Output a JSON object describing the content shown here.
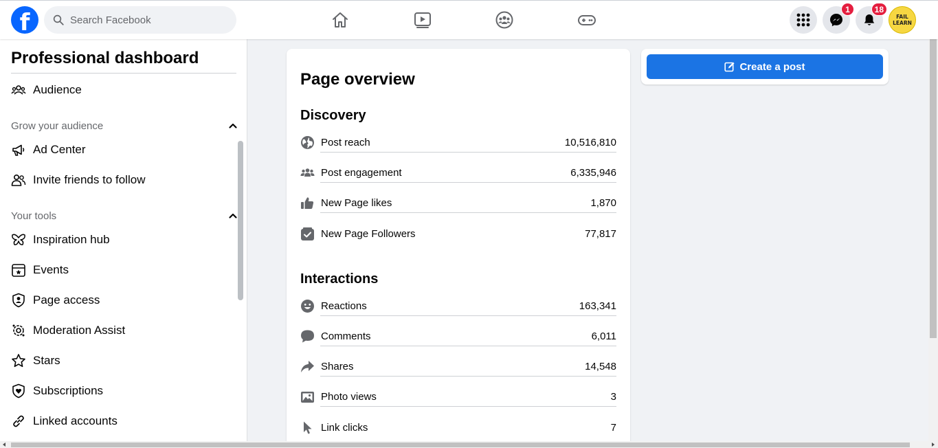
{
  "header": {
    "logo_letter": "f",
    "search_placeholder": "Search Facebook",
    "nav_icons": [
      "home-icon",
      "video-icon",
      "groups-icon",
      "gaming-icon"
    ],
    "menu_icon": "grid-menu-icon",
    "messenger_badge": "1",
    "notifications_badge": "18",
    "avatar_text": "FAIL LEARN",
    "avatar_color": "#f6d742",
    "brand_color": "#0866ff"
  },
  "sidebar": {
    "title": "Professional dashboard",
    "audience": "Audience",
    "grow_header": "Grow your audience",
    "grow_items": [
      "Ad Center",
      "Invite friends to follow"
    ],
    "tools_header": "Your tools",
    "tools_items": [
      "Inspiration hub",
      "Events",
      "Page access",
      "Moderation Assist",
      "Stars",
      "Subscriptions",
      "Linked accounts"
    ]
  },
  "overview": {
    "title": "Page overview",
    "discovery_title": "Discovery",
    "discovery": [
      {
        "label": "Post reach",
        "value": "10,516,810",
        "icon": "globe-icon"
      },
      {
        "label": "Post engagement",
        "value": "6,335,946",
        "icon": "people-icon"
      },
      {
        "label": "New Page likes",
        "value": "1,870",
        "icon": "thumbs-up-icon"
      },
      {
        "label": "New Page Followers",
        "value": "77,817",
        "icon": "follow-check-icon"
      }
    ],
    "interactions_title": "Interactions",
    "interactions": [
      {
        "label": "Reactions",
        "value": "163,341",
        "icon": "smiley-icon"
      },
      {
        "label": "Comments",
        "value": "6,011",
        "icon": "comment-icon"
      },
      {
        "label": "Shares",
        "value": "14,548",
        "icon": "share-icon"
      },
      {
        "label": "Photo views",
        "value": "3",
        "icon": "photo-icon"
      },
      {
        "label": "Link clicks",
        "value": "7",
        "icon": "cursor-icon"
      }
    ]
  },
  "right": {
    "create_post": "Create a post",
    "button_color": "#1b74e4"
  }
}
